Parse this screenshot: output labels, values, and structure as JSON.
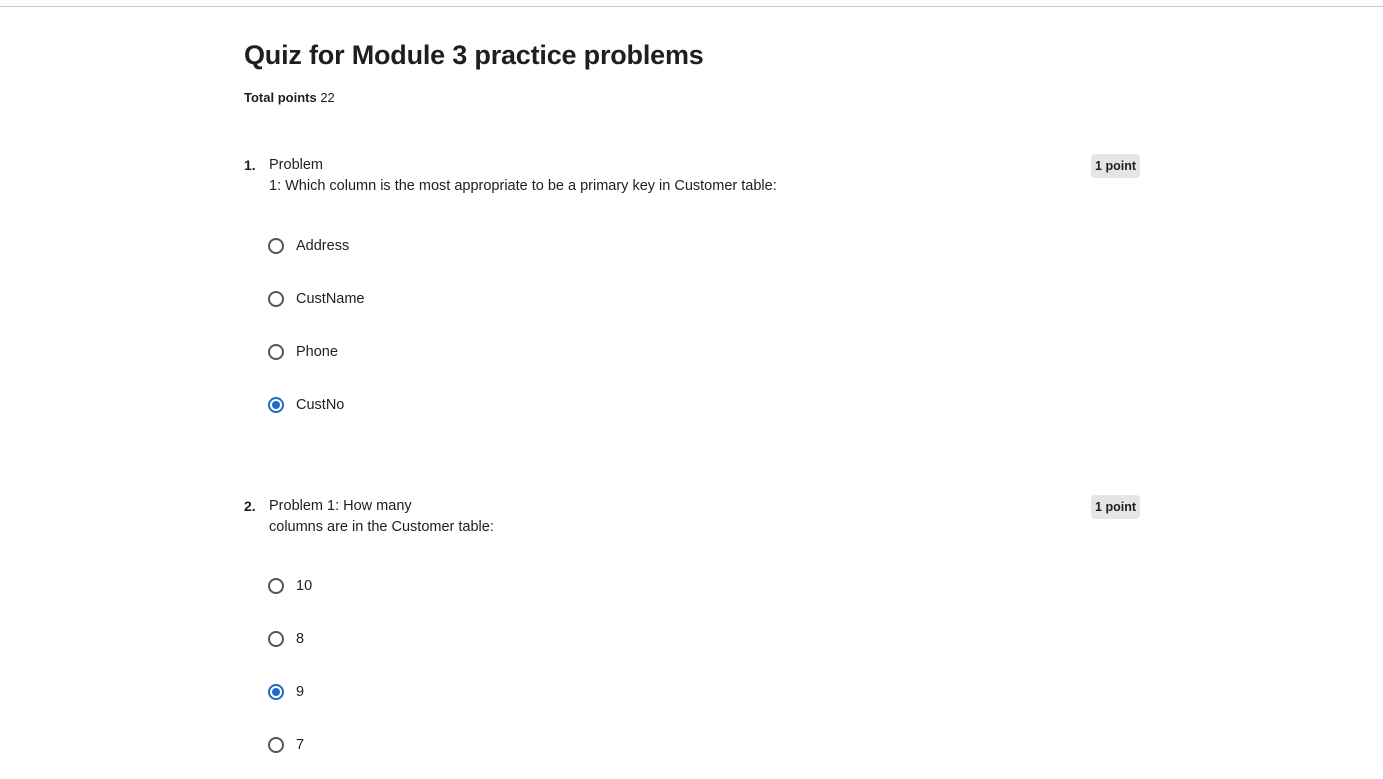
{
  "quiz": {
    "title": "Quiz for Module 3 practice problems",
    "total_points_label": "Total points",
    "total_points_value": "22"
  },
  "questions": [
    {
      "number": "1.",
      "text_line1": "Problem",
      "text_line2": "1: Which column is the most appropriate to be a primary key in Customer table:",
      "points": "1 point",
      "options": [
        {
          "label": "Address",
          "selected": false
        },
        {
          "label": "CustName",
          "selected": false
        },
        {
          "label": "Phone",
          "selected": false
        },
        {
          "label": "CustNo",
          "selected": true
        }
      ]
    },
    {
      "number": "2.",
      "text_line1": "Problem 1: How many",
      "text_line2": "columns are in the Customer table:",
      "points": "1 point",
      "options": [
        {
          "label": "10",
          "selected": false
        },
        {
          "label": "8",
          "selected": false
        },
        {
          "label": "9",
          "selected": true
        },
        {
          "label": "7",
          "selected": false
        }
      ]
    }
  ],
  "colors": {
    "accent": "#1f69c7",
    "badge_bg": "#e5e5e5",
    "text": "#1f1f1f"
  }
}
